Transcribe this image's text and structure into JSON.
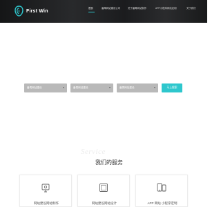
{
  "header": {
    "logo_text": "First Win",
    "nav": [
      {
        "label": "首页",
        "active": true
      },
      {
        "label": "番禺网站建设公司",
        "active": false
      },
      {
        "label": "关于番禺网站制作",
        "active": false
      },
      {
        "label": "APP小程序网站定制",
        "active": false
      },
      {
        "label": "关于我们",
        "active": false
      }
    ]
  },
  "search": {
    "select1": "番禺网站建设",
    "select2": "番禺网站建设",
    "select3": "番禺网站建设",
    "button": "马上搜索"
  },
  "services": {
    "title_en": "Service",
    "title_cn": "我们的服务",
    "cards": [
      {
        "icon": "monitor-icon",
        "text": "网站建设网站制作"
      },
      {
        "icon": "square-frame-icon",
        "text": "网站建设网站设计"
      },
      {
        "icon": "mobile-devices-icon",
        "text": "APP  网站  小程序定制"
      }
    ]
  },
  "colors": {
    "accent": "#2ec7cd",
    "header_bg": "#1c1d1f",
    "select_bg": "#b9b9b9"
  }
}
